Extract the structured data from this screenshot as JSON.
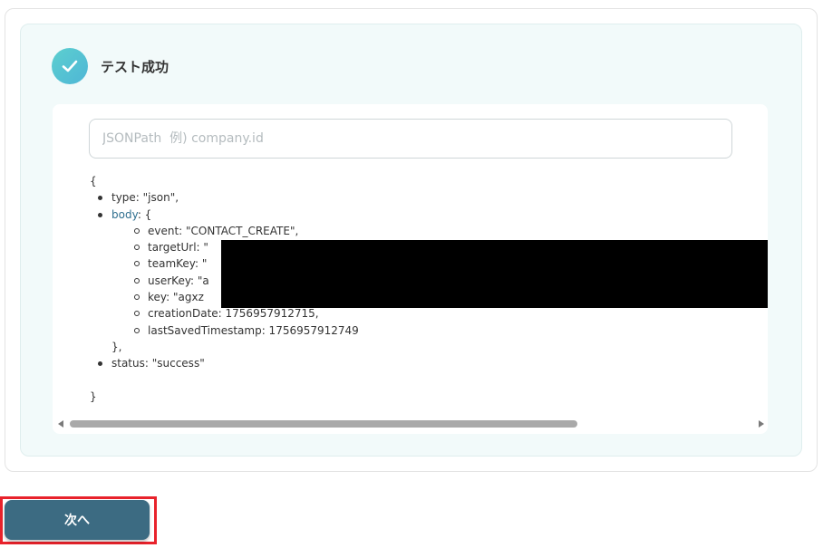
{
  "status": {
    "title": "テスト成功",
    "icon": "check-icon",
    "accent": "#5ccfcf"
  },
  "jsonpath": {
    "placeholder": "JSONPath  例) company.id",
    "value": ""
  },
  "json": {
    "open": "{",
    "type_line": "type: \"json\",",
    "body_key": "body",
    "body_open": ": {",
    "event_line": "event: \"CONTACT_CREATE\",",
    "targetUrl_line": "targetUrl: \"",
    "teamKey_line": "teamKey: \"",
    "userKey_line": "userKey: \"a",
    "key_line": "key: \"agxz",
    "creationDate_line": "creationDate: 1756957912715,",
    "lastSaved_line": "lastSavedTimestamp: 1756957912749",
    "body_close": "},",
    "status_line": "status: \"success\"",
    "close": "}",
    "overflow_char": "1"
  },
  "footer": {
    "next_label": "次へ",
    "button_color": "#3c6b82",
    "highlight_color": "#e8222b"
  }
}
